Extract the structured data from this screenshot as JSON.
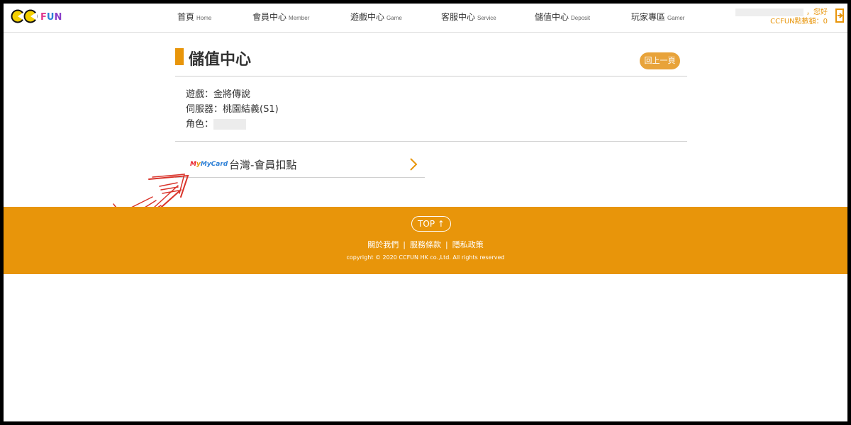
{
  "header": {
    "logo_text": "CC FUN",
    "nav": [
      {
        "zh": "首頁",
        "en": "Home"
      },
      {
        "zh": "會員中心",
        "en": "Member"
      },
      {
        "zh": "遊戲中心",
        "en": "Game"
      },
      {
        "zh": "客服中心",
        "en": "Service"
      },
      {
        "zh": "儲值中心",
        "en": "Deposit"
      },
      {
        "zh": "玩家專區",
        "en": "Gamer"
      }
    ],
    "greeting": "，您好",
    "points": "CCFUN點數額：0"
  },
  "main": {
    "title": "儲值中心",
    "back_label": "回上一頁",
    "game": "遊戲：金將傳說",
    "server": "伺服器：桃園結義(S1)",
    "role_label": "角色：",
    "payment": {
      "brand": "MyCard",
      "label": "台灣-會員扣點"
    }
  },
  "footer": {
    "top_label": "TOP ↑",
    "links": [
      "關於我們",
      "服務條款",
      "隱私政策"
    ],
    "copyright": "copyright © 2020 CCFUN HK co.,Ltd. All rights reserved"
  },
  "colors": {
    "accent": "#e8950a",
    "annotation": "#d9342b"
  }
}
